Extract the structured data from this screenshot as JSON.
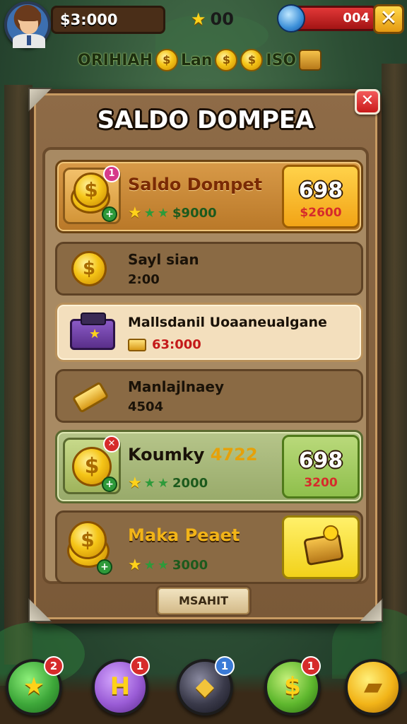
{
  "hud": {
    "money": "$3:000",
    "stars": "00",
    "gems": "004",
    "close_symbol": "✕",
    "ticker": {
      "text1": "ORIHIAH",
      "text2": "Lan",
      "text3": "ISO"
    }
  },
  "panel": {
    "title": "SALDO DOMPEA",
    "close_symbol": "✕",
    "bottom_button": "MSAHIT",
    "rows": [
      {
        "title": "Saldo Dompet",
        "badge": "1",
        "stars_amount": "$9000",
        "price_main": "698",
        "price_minor": "$2600"
      },
      {
        "title": "Sayl sian",
        "sub": "2:00"
      },
      {
        "title": "Mallsdanil Uoaaneualgane",
        "sub": "63:000"
      },
      {
        "title": "Manlajlnaey",
        "sub": "4504"
      },
      {
        "title": "Koumky",
        "title_accent": "4722",
        "badge": "✕",
        "stars_amount": "2000",
        "price_main": "698",
        "price_minor": "3200"
      },
      {
        "title": "Maka Peaet",
        "stars_amount": "3000"
      }
    ]
  },
  "nav": {
    "items": [
      {
        "name": "star",
        "symbol": "★",
        "badge": "2",
        "color": "#3ea83a"
      },
      {
        "name": "h",
        "symbol": "H",
        "badge": "1",
        "color": "#9a5cd6"
      },
      {
        "name": "box",
        "symbol": "◆",
        "badge": "1",
        "color": "#3a3a4a"
      },
      {
        "name": "dollar",
        "symbol": "$",
        "badge": "1",
        "color": "#5fb82e"
      },
      {
        "name": "ticket",
        "symbol": "▰",
        "badge": "",
        "color": "#f2b418"
      }
    ]
  },
  "colors": {
    "panel_brown": "#8e6b47",
    "gold": "#f5c518",
    "red": "#d62b2b",
    "green": "#2e9a3a"
  }
}
